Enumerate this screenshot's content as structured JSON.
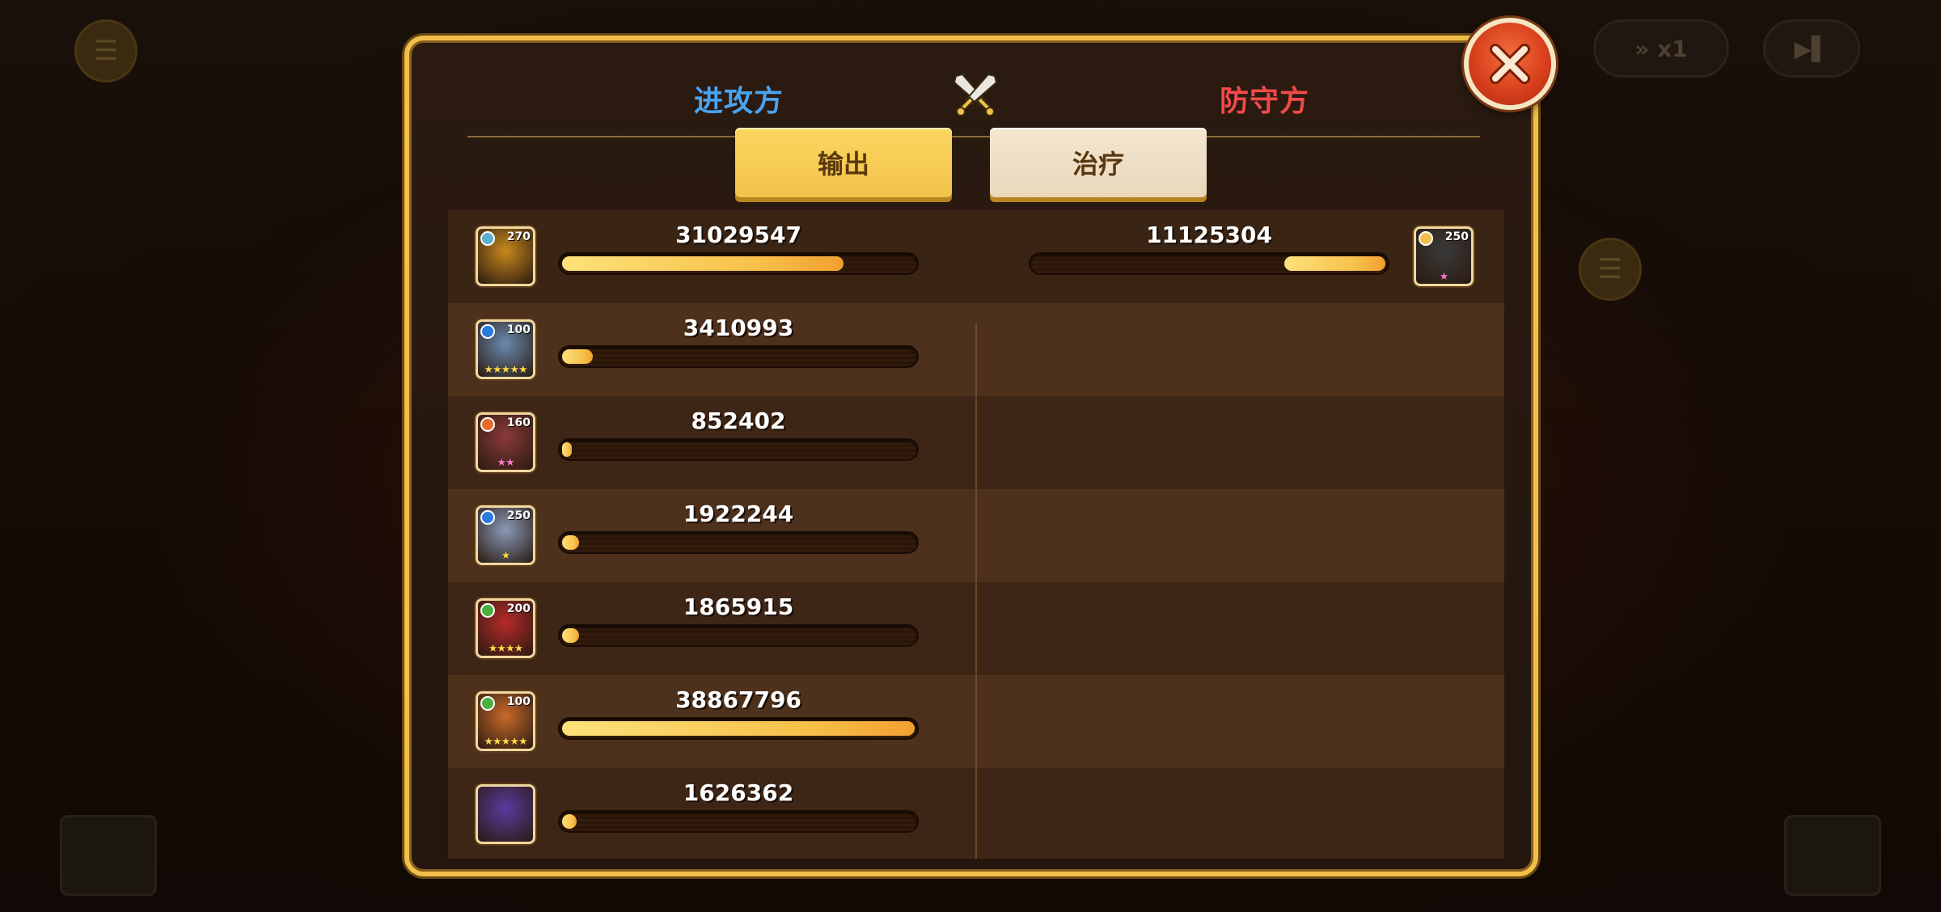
{
  "tabs": {
    "attacker_label": "进攻方",
    "defender_label": "防守方",
    "damage_label": "输出",
    "healing_label": "治疗"
  },
  "colors": {
    "attacker": "#4aa3f0",
    "defender": "#f04a4a",
    "frame": "#f2c04a",
    "bar_fill": "#f7c04a",
    "close_button": "#d9401c"
  },
  "attackers": [
    {
      "level": "270",
      "value": "31029547",
      "fill": 0.798,
      "element": "dark",
      "stars": "",
      "portrait_color": "#c8891c"
    },
    {
      "level": "100",
      "value": "3410993",
      "fill": 0.088,
      "element": "water",
      "stars": "★★★★★",
      "portrait_color": "#6a8ab0"
    },
    {
      "level": "160",
      "value": "852402",
      "fill": 0.022,
      "element": "fire",
      "stars": "★★",
      "portrait_color": "#8a3a3a"
    },
    {
      "level": "250",
      "value": "1922244",
      "fill": 0.049,
      "element": "water",
      "stars": "★",
      "portrait_color": "#8a9ab8"
    },
    {
      "level": "200",
      "value": "1865915",
      "fill": 0.048,
      "element": "nature",
      "stars": "★★★★",
      "portrait_color": "#b82a2a"
    },
    {
      "level": "100",
      "value": "38867796",
      "fill": 1.0,
      "element": "nature",
      "stars": "★★★★★",
      "portrait_color": "#c86a2a"
    },
    {
      "level": "",
      "value": "1626362",
      "fill": 0.042,
      "element": "",
      "stars": "",
      "portrait_color": "#5a3aa0"
    }
  ],
  "defenders": [
    {
      "level": "250",
      "value": "11125304",
      "fill": 0.286,
      "element": "light",
      "stars": "★",
      "portrait_color": "#3a3a3a"
    }
  ]
}
